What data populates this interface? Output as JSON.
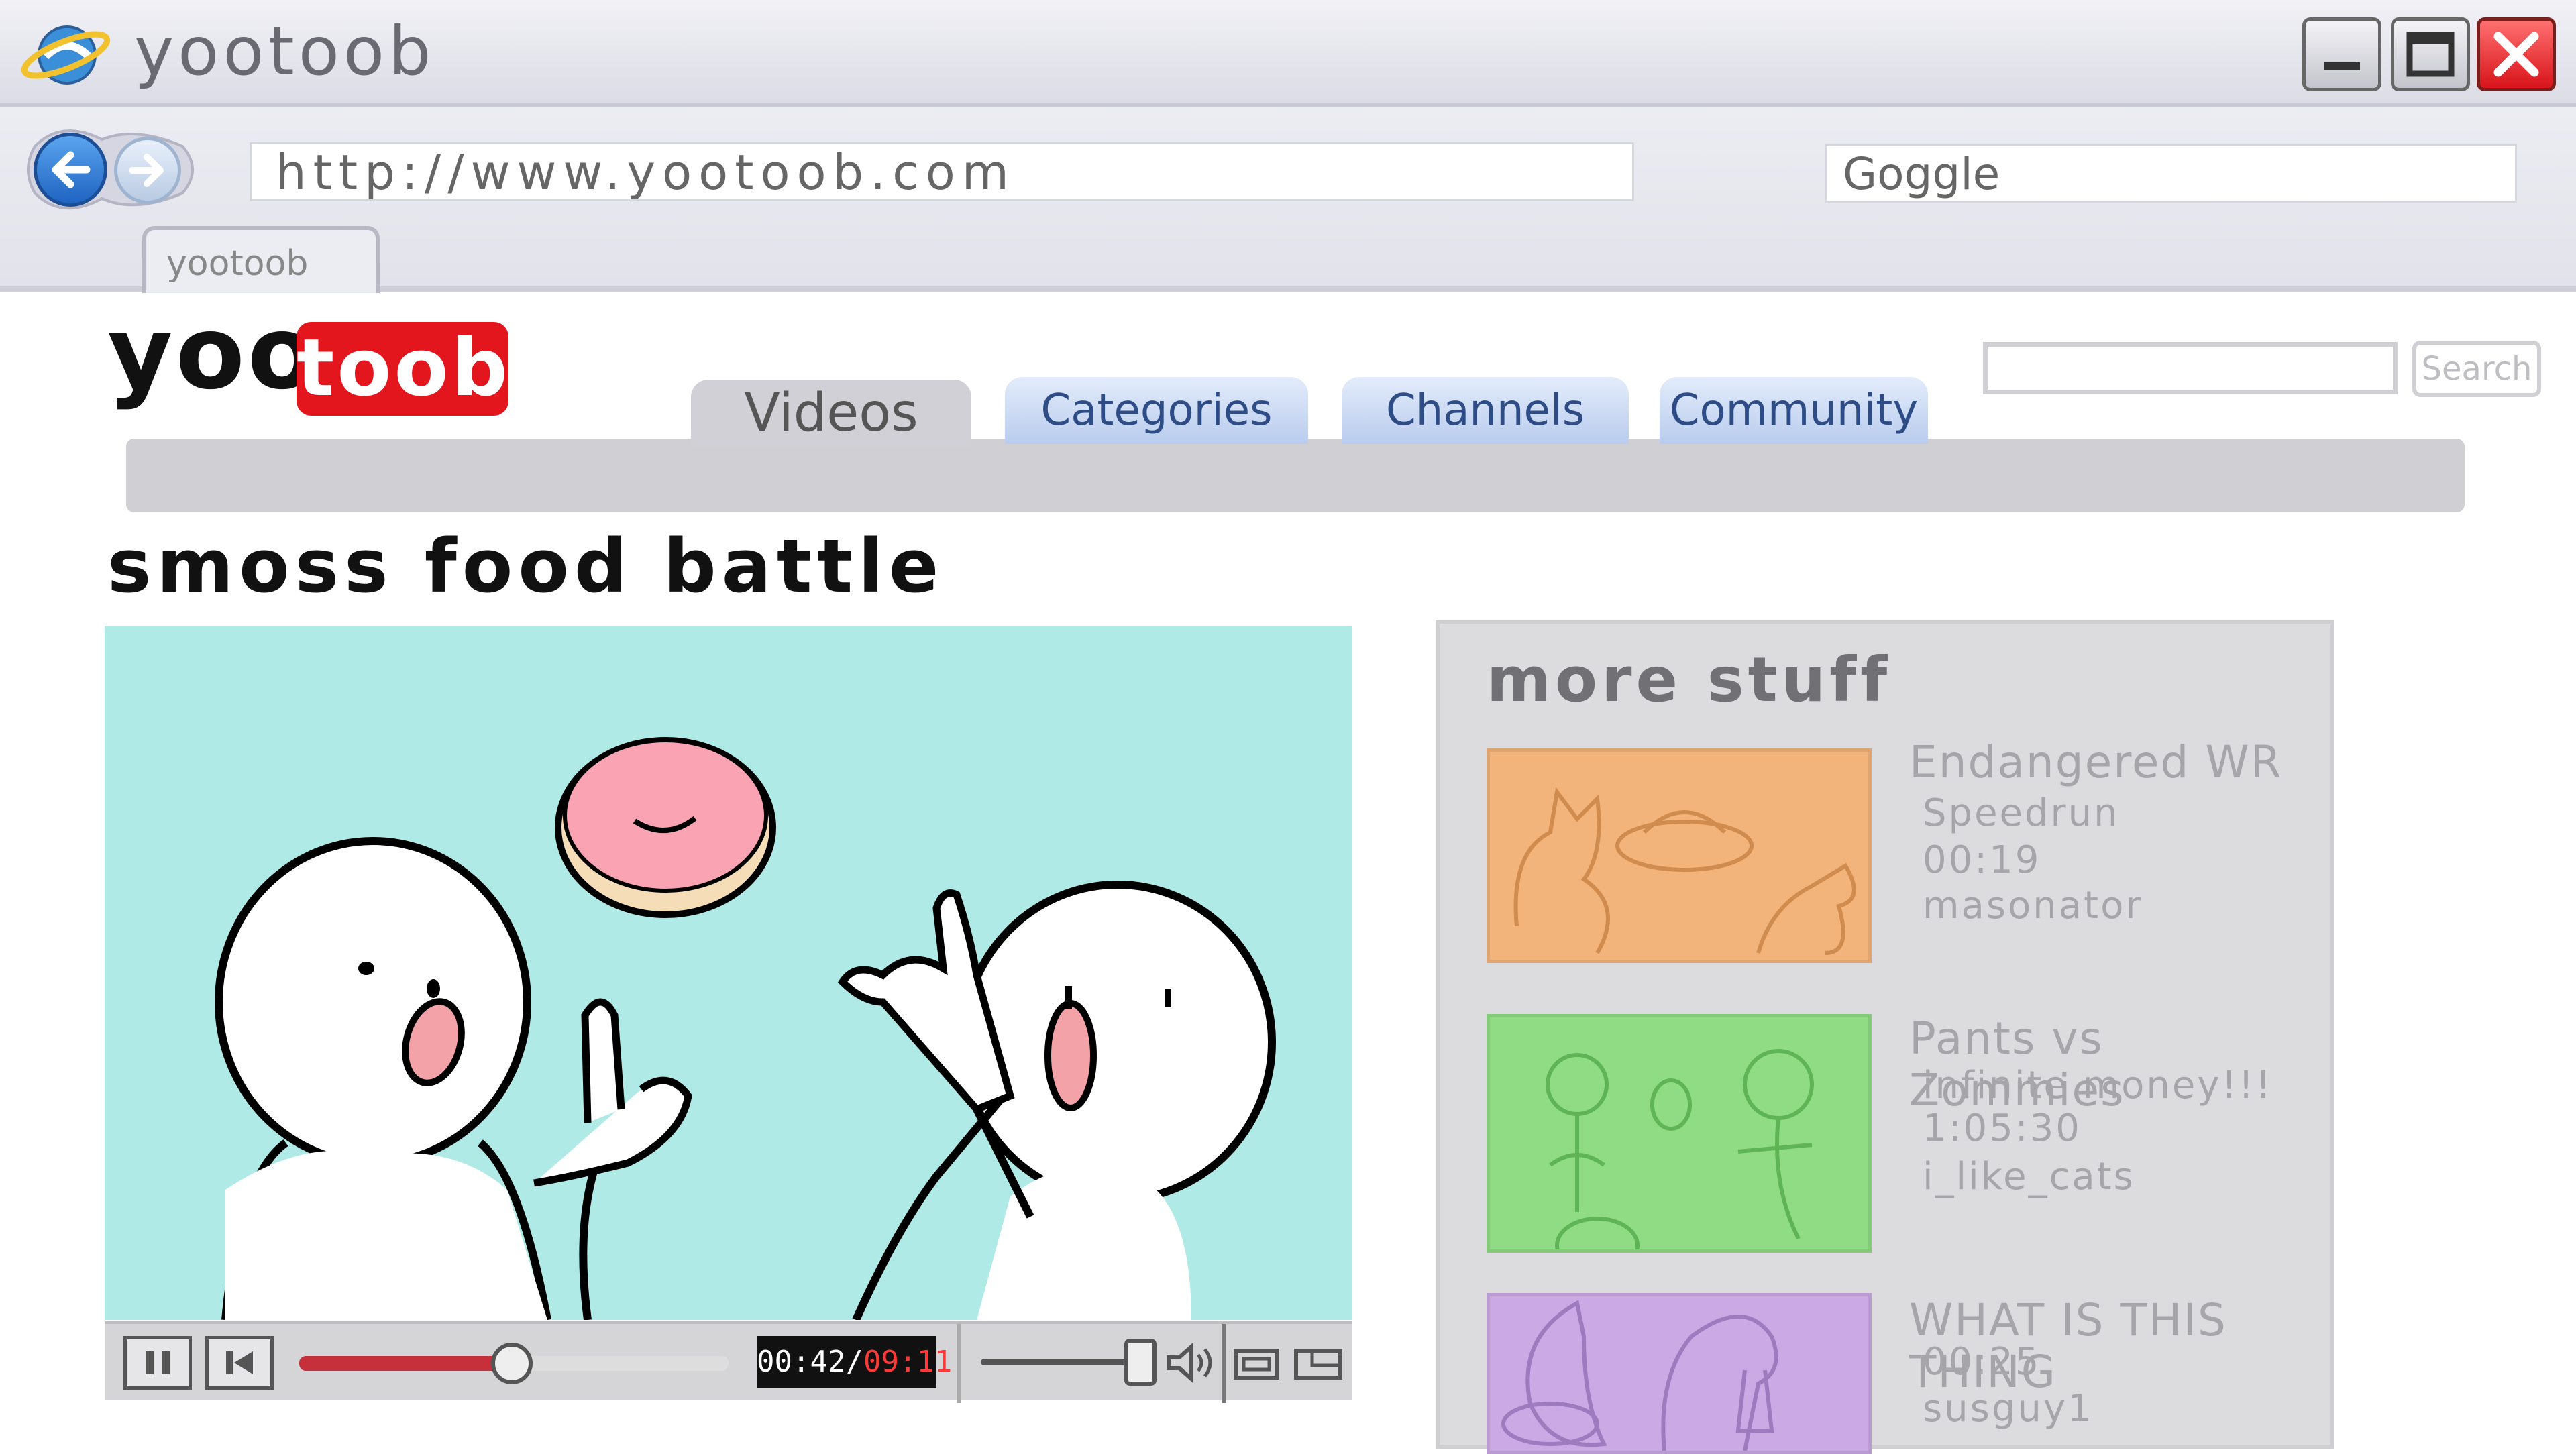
{
  "window": {
    "title": "yootoob",
    "url": "http://www.yootoob.com",
    "search_placeholder": "Goggle",
    "tab_label": "yootoob"
  },
  "site": {
    "logo_yoo": "yoo",
    "logo_toob": "toob",
    "nav": [
      "Videos",
      "Categories",
      "Channels",
      "Community"
    ],
    "search_button": "Search",
    "accent": "#e2161c"
  },
  "video": {
    "title": "smoss food battle",
    "current_time": "00:42",
    "total_time": "09:11",
    "progress": 0.5
  },
  "sidebar": {
    "title": "more stuff",
    "items": [
      {
        "title": "Endangered WR",
        "lines": [
          "Speedrun",
          "00:19",
          "masonator"
        ],
        "color": "#f2b47a"
      },
      {
        "title": "Pants vs Zommies",
        "lines": [
          "infinite money!!!",
          "1:05:30",
          "i_like_cats"
        ],
        "color": "#8fdc84"
      },
      {
        "title": "WHAT IS THIS THING",
        "lines": [
          "00:25",
          "susguy1"
        ],
        "color": "#caa9e4"
      }
    ]
  }
}
